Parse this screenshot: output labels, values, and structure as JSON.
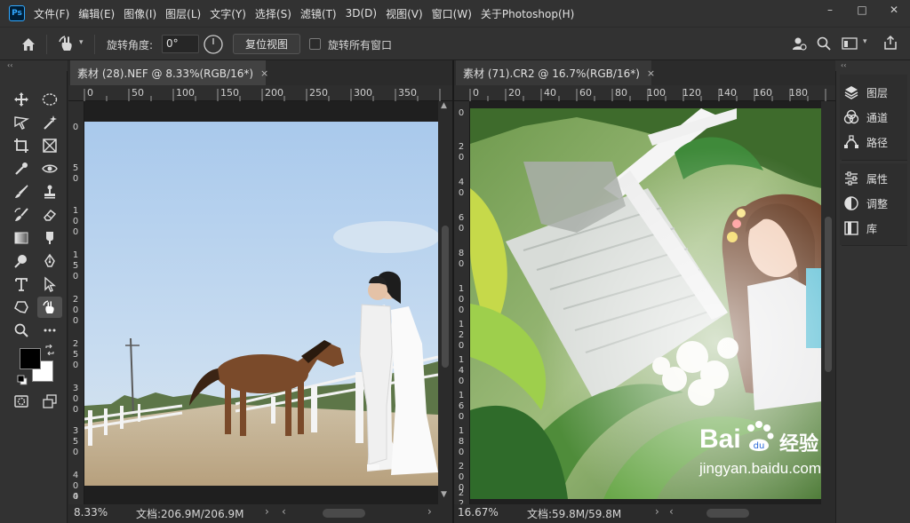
{
  "app": {
    "logo": "Ps",
    "menu": [
      "文件(F)",
      "编辑(E)",
      "图像(I)",
      "图层(L)",
      "文字(Y)",
      "选择(S)",
      "滤镜(T)",
      "3D(D)",
      "视图(V)",
      "窗口(W)",
      "关于Photoshop(H)"
    ],
    "window_controls": [
      "–",
      "□",
      "✕"
    ]
  },
  "options": {
    "rotate_label": "旋转角度:",
    "rotate_value": "0°",
    "reset_view": "复位视图",
    "rotate_all_windows": "旋转所有窗口"
  },
  "collapse_glyph": "‹‹",
  "left_doc": {
    "tab_title": "素材 (28).NEF @ 8.33%(RGB/16*)",
    "close": "×",
    "ruler_h": [
      "0",
      "50",
      "100",
      "150",
      "200",
      "250",
      "300",
      "350"
    ],
    "ruler_v": [
      "0",
      "5\n0",
      "1\n0\n0",
      "1\n5\n0",
      "2\n0\n0",
      "2\n5\n0",
      "3\n0\n0",
      "3\n5\n0",
      "4\n0\n0",
      "4"
    ],
    "zoom": "8.33%",
    "doc_info": "文档:206.9M/206.9M"
  },
  "right_doc": {
    "tab_title": "素材 (71).CR2 @ 16.7%(RGB/16*)",
    "close": "×",
    "ruler_h": [
      "0",
      "20",
      "40",
      "60",
      "80",
      "100",
      "120",
      "140",
      "160",
      "180"
    ],
    "ruler_v": [
      "0",
      "2\n0",
      "4\n0",
      "6\n0",
      "8\n0",
      "1\n0\n0",
      "1\n2\n0",
      "1\n4\n0",
      "1\n6\n0",
      "1\n8\n0",
      "2\n0\n0",
      "2\n2"
    ],
    "zoom": "16.67%",
    "doc_info": "文档:59.8M/59.8M"
  },
  "panels": [
    {
      "label": "图层",
      "icon": "layers-icon"
    },
    {
      "label": "通道",
      "icon": "channels-icon"
    },
    {
      "label": "路径",
      "icon": "paths-icon"
    },
    {
      "label": "属性",
      "icon": "properties-icon"
    },
    {
      "label": "调整",
      "icon": "adjustments-icon"
    },
    {
      "label": "库",
      "icon": "libraries-icon"
    }
  ],
  "watermark": {
    "brand": "Bai",
    "brand_tail": "经验",
    "url": "jingyan.baidu.com"
  },
  "colors": {
    "foreground": "#000000",
    "background": "#ffffff",
    "accent": "#31a8ff"
  }
}
